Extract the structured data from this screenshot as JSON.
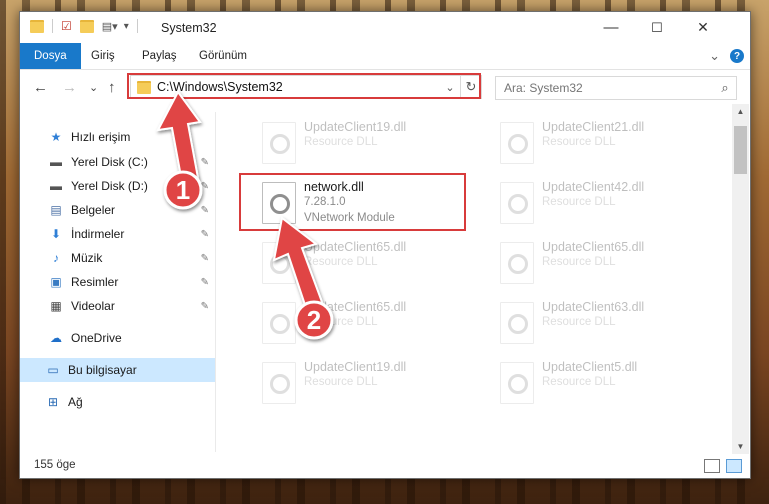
{
  "window": {
    "title": "System32",
    "controls": {
      "minimize": "—",
      "maximize": "☐",
      "close": "✕"
    }
  },
  "ribbon": {
    "tabs": [
      "Dosya",
      "Giriş",
      "Paylaş",
      "Görünüm"
    ],
    "active_tab": "Dosya",
    "expand_glyph": "⌄",
    "help_glyph": "?"
  },
  "nav": {
    "back": "←",
    "forward": "→",
    "recent": "⌄",
    "up": "↑",
    "address": "C:\\Windows\\System32",
    "address_dropdown": "⌄",
    "refresh": "↻",
    "search_placeholder": "Ara: System32",
    "search_glyph": "⌕"
  },
  "sidebar": {
    "items": [
      {
        "label": "Hızlı erişim",
        "icon": "star-icon",
        "glyph": "★",
        "color": "#2f7fd6",
        "pinned": false
      },
      {
        "label": "Yerel Disk (C:)",
        "icon": "drive-icon",
        "glyph": "▬",
        "color": "#555555",
        "pinned": true
      },
      {
        "label": "Yerel Disk (D:)",
        "icon": "drive-icon",
        "glyph": "▬",
        "color": "#555555",
        "pinned": true
      },
      {
        "label": "Belgeler",
        "icon": "documents-icon",
        "glyph": "▤",
        "color": "#4a6fa5",
        "pinned": true
      },
      {
        "label": "İndirmeler",
        "icon": "download-icon",
        "glyph": "⬇",
        "color": "#2f7fd6",
        "pinned": true
      },
      {
        "label": "Müzik",
        "icon": "music-icon",
        "glyph": "♪",
        "color": "#2f7fd6",
        "pinned": true
      },
      {
        "label": "Resimler",
        "icon": "pictures-icon",
        "glyph": "▣",
        "color": "#3a7cc3",
        "pinned": true
      },
      {
        "label": "Videolar",
        "icon": "video-icon",
        "glyph": "▦",
        "color": "#444444",
        "pinned": true
      },
      {
        "label": "OneDrive",
        "icon": "cloud-icon",
        "glyph": "☁",
        "color": "#1f6fc9",
        "pinned": false
      },
      {
        "label": "Bu bilgisayar",
        "icon": "computer-icon",
        "glyph": "▭",
        "color": "#2a6bb5",
        "pinned": false,
        "selected": true
      },
      {
        "label": "Ağ",
        "icon": "network-icon",
        "glyph": "⊞",
        "color": "#2a6bb5",
        "pinned": false
      }
    ],
    "pin_glyph": "✎"
  },
  "files": {
    "left": [
      {
        "name": "UpdateClient19.dll",
        "type": "Resource DLL"
      },
      {
        "name": "network.dll",
        "version": "7.28.1.0",
        "type": "VNetwork Module",
        "focused": true
      },
      {
        "name": "UpdateClient65.dll",
        "type": "Resource DLL"
      },
      {
        "name": "UpdateClient65.dll",
        "type": "Resource DLL"
      },
      {
        "name": "UpdateClient19.dll",
        "type": "Resource DLL"
      }
    ],
    "right": [
      {
        "name": "UpdateClient21.dll",
        "type": "Resource DLL"
      },
      {
        "name": "UpdateClient42.dll",
        "type": "Resource DLL"
      },
      {
        "name": "UpdateClient65.dll",
        "type": "Resource DLL"
      },
      {
        "name": "UpdateClient63.dll",
        "type": "Resource DLL"
      },
      {
        "name": "UpdateClient5.dll",
        "type": "Resource DLL"
      }
    ]
  },
  "status": {
    "item_count": "155 öge"
  },
  "annotations": {
    "marker1": "1",
    "marker2": "2",
    "highlight_color": "#d83b3b"
  },
  "colors": {
    "accent": "#1979ca",
    "selection": "#cce8ff"
  }
}
